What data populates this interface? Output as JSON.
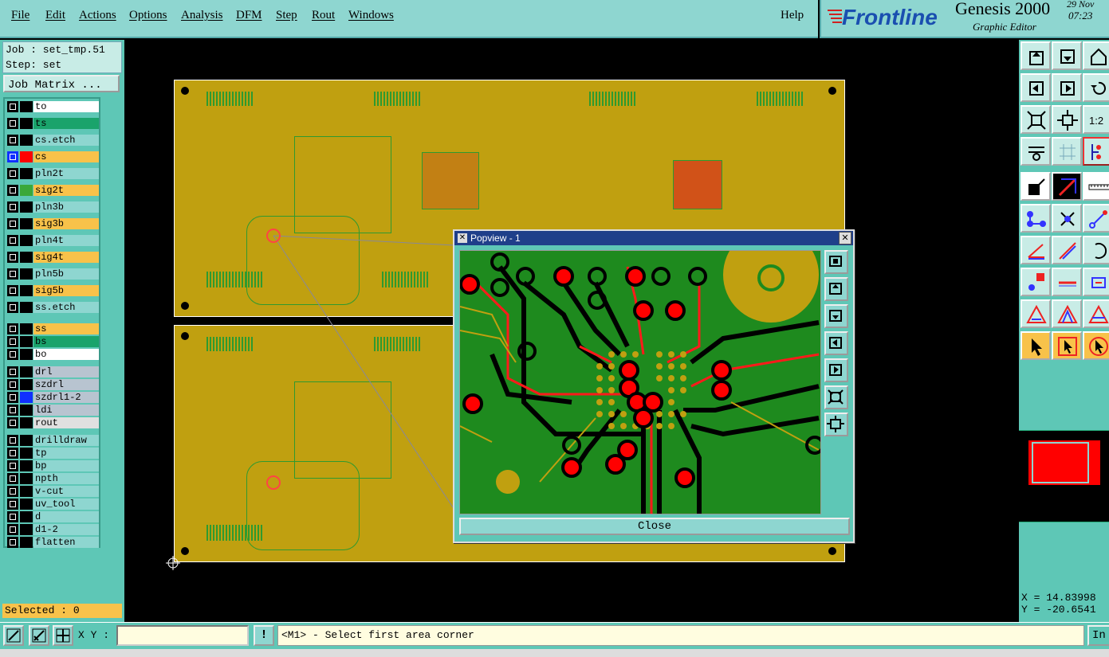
{
  "menubar": {
    "items": [
      "File",
      "Edit",
      "Actions",
      "Options",
      "Analysis",
      "DFM",
      "Step",
      "Rout",
      "Windows"
    ],
    "help": "Help"
  },
  "brand": {
    "logo_text": "Frontline",
    "product": "Genesis 2000",
    "subtitle": "Graphic Editor",
    "date": "29 Nov",
    "time": "07:23"
  },
  "job": {
    "job_line": "Job : set_tmp.51",
    "step_line": "Step: set",
    "matrix_button": "Job Matrix ..."
  },
  "layers": [
    {
      "name": "to",
      "color": "#ffffff"
    },
    {
      "name": "ts",
      "color": "#1aa36b"
    },
    {
      "name": "cs.etch",
      "color": "#8ed6d0"
    },
    {
      "name": "cs",
      "color": "#f8c24a",
      "swatch": "#ff0000",
      "active": true
    },
    {
      "name": "pln2t",
      "color": "#8ed6d0"
    },
    {
      "name": "sig2t",
      "color": "#f8c24a",
      "swatch": "#3aa83a"
    },
    {
      "name": "pln3b",
      "color": "#8ed6d0"
    },
    {
      "name": "sig3b",
      "color": "#f8c24a"
    },
    {
      "name": "pln4t",
      "color": "#8ed6d0"
    },
    {
      "name": "sig4t",
      "color": "#f8c24a"
    },
    {
      "name": "pln5b",
      "color": "#8ed6d0"
    },
    {
      "name": "sig5b",
      "color": "#f8c24a"
    },
    {
      "name": "ss.etch",
      "color": "#8ed6d0"
    },
    {
      "name": "ss",
      "color": "#f8c24a"
    },
    {
      "name": "bs",
      "color": "#1aa36b"
    },
    {
      "name": "bo",
      "color": "#ffffff"
    },
    {
      "name": "drl",
      "color": "#b8c4d0"
    },
    {
      "name": "szdrl",
      "color": "#b8c4d0"
    },
    {
      "name": "szdrl1-2",
      "color": "#b8c4d0",
      "swatch": "#1030ff"
    },
    {
      "name": "ldi",
      "color": "#b8c4d0"
    },
    {
      "name": "rout",
      "color": "#e0e0e0"
    },
    {
      "name": "drilldraw",
      "color": "#8ed6d0"
    },
    {
      "name": "tp",
      "color": "#8ed6d0"
    },
    {
      "name": "bp",
      "color": "#8ed6d0"
    },
    {
      "name": "npth",
      "color": "#8ed6d0"
    },
    {
      "name": "v-cut",
      "color": "#8ed6d0"
    },
    {
      "name": "uv_tool",
      "color": "#8ed6d0"
    },
    {
      "name": "d",
      "color": "#8ed6d0"
    },
    {
      "name": "d1-2",
      "color": "#8ed6d0"
    },
    {
      "name": "flatten",
      "color": "#8ed6d0"
    }
  ],
  "selected": "Selected : 0",
  "popview": {
    "title": "Popview - 1",
    "close_label": "Close",
    "title_close_glyph": "✕"
  },
  "coords": {
    "x": "X = 14.83998",
    "y": "Y = -20.6541"
  },
  "statusbar": {
    "xy_label": "X Y :",
    "xy_value": "",
    "alert_glyph": "!",
    "prompt": "<M1> - Select first area corner",
    "in_button": "In"
  },
  "colors": {
    "panel": "#5ec7b6",
    "menubar": "#8ed6d0",
    "board": "#c0a010",
    "copper_green": "#1e8a1e",
    "pad_red": "#ff0000",
    "popview_title": "#1f3f8a"
  },
  "icons": [
    "snap-icon",
    "measure-icon",
    "grid-icon",
    "home-icon",
    "zoom-home-icon",
    "pan-left-icon",
    "pan-right-icon",
    "undo-icon",
    "fit-icon",
    "center-icon",
    "ratio-icon",
    "layer-icon",
    "grid-view-icon",
    "net-icon"
  ]
}
